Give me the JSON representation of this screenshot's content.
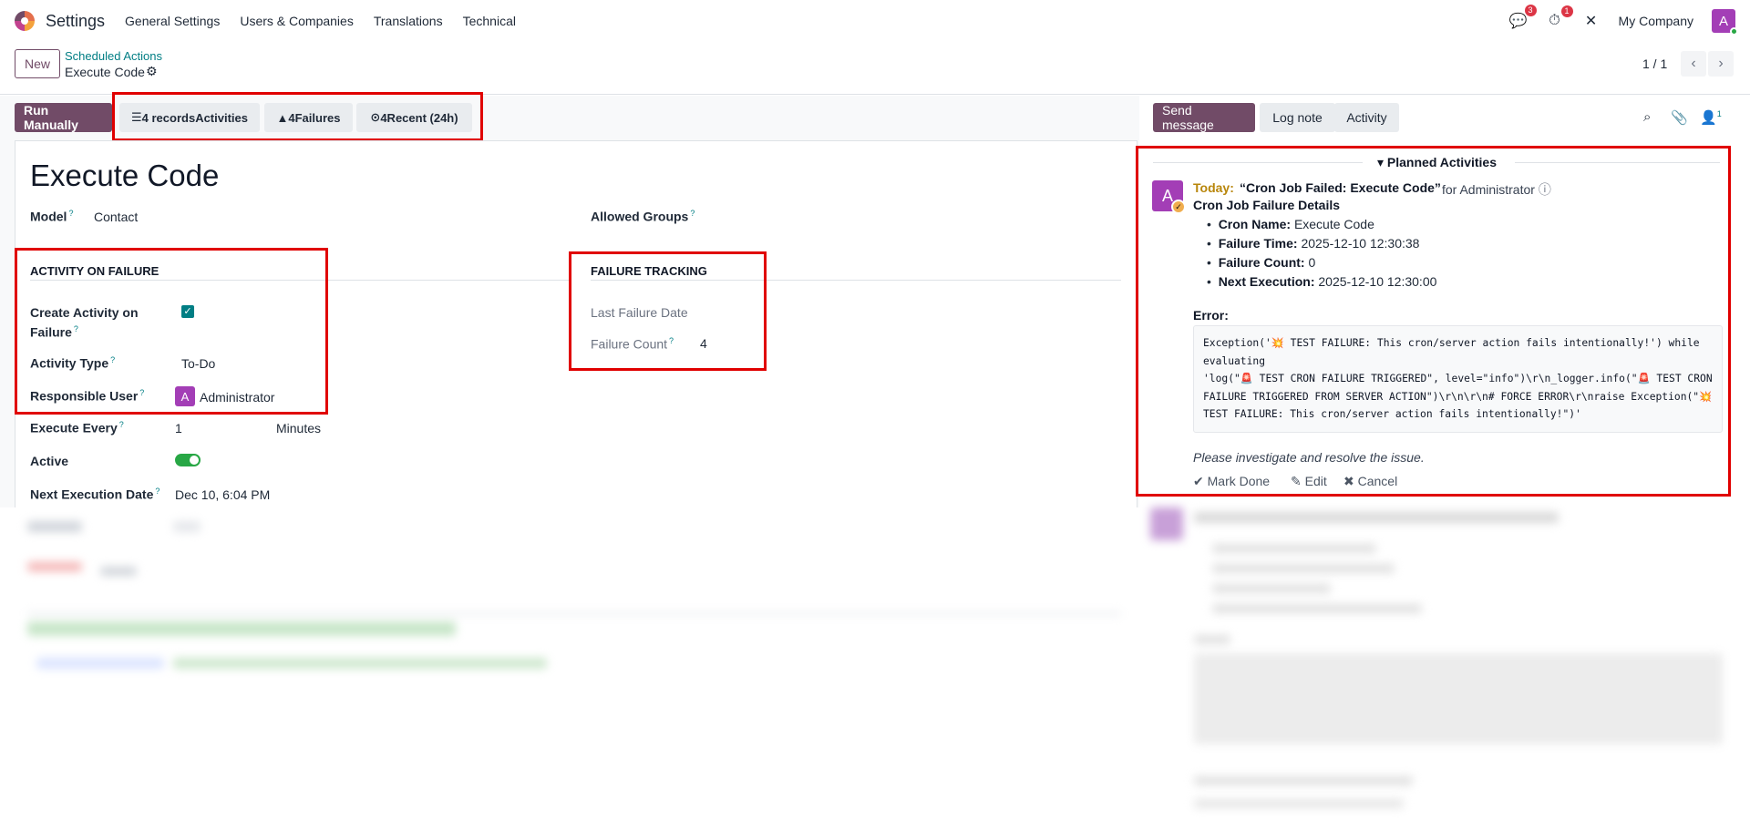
{
  "navbar": {
    "app_name": "Settings",
    "menu": [
      "General Settings",
      "Users & Companies",
      "Translations",
      "Technical"
    ],
    "messages_badge": "3",
    "activities_badge": "1",
    "company": "My Company",
    "user_initial": "A"
  },
  "control": {
    "new_label": "New",
    "breadcrumb": "Scheduled Actions",
    "record_name": "Execute Code",
    "pager": "1 / 1"
  },
  "buttons": {
    "run_manually": "Run Manually",
    "activities": "4 recordsActivities",
    "failures": "4Failures",
    "recent": "4Recent (24h)"
  },
  "form": {
    "title": "Execute Code",
    "model_label": "Model",
    "model_value": "Contact",
    "allowed_groups_label": "Allowed Groups",
    "activity_section": "ACTIVITY ON FAILURE",
    "create_activity_label_1": "Create Activity on",
    "create_activity_label_2": "Failure",
    "activity_type_label": "Activity Type",
    "activity_type_value": "To-Do",
    "responsible_label": "Responsible User",
    "responsible_value": "Administrator",
    "responsible_initial": "A",
    "execute_every_label": "Execute Every",
    "execute_every_value": "1",
    "execute_every_unit": "Minutes",
    "active_label": "Active",
    "next_exec_label": "Next Execution Date",
    "next_exec_value": "Dec 10, 6:04 PM",
    "failure_section": "FAILURE TRACKING",
    "last_failure_label": "Last Failure Date",
    "failure_count_label": "Failure Count",
    "failure_count_value": "4"
  },
  "chatter": {
    "send_message": "Send message",
    "log_note": "Log note",
    "activity": "Activity",
    "followers_count": "1",
    "planned_title": "Planned Activities",
    "avatar_initial": "A",
    "today": "Today:",
    "summary": "“Cron Job Failed: Execute Code”",
    "for_user": "for Administrator",
    "details_title": "Cron Job Failure Details",
    "bullets": [
      {
        "key": "Cron Name:",
        "value": "Execute Code"
      },
      {
        "key": "Failure Time:",
        "value": "2025-12-10 12:30:38"
      },
      {
        "key": "Failure Count:",
        "value": "0"
      },
      {
        "key": "Next Execution:",
        "value": "2025-12-10 12:30:00"
      }
    ],
    "error_label": "Error:",
    "error_code": "Exception('💥 TEST FAILURE: This cron/server action fails intentionally!') while evaluating\n'log(\"🚨 TEST CRON FAILURE TRIGGERED\", level=\"info\")\\r\\n_logger.info(\"🚨 TEST CRON FAILURE TRIGGERED FROM SERVER ACTION\")\\r\\n\\r\\n# FORCE ERROR\\r\\nraise Exception(\"💥 TEST FAILURE: This cron/server action fails intentionally!\")'",
    "investigate": "Please investigate and resolve the issue.",
    "mark_done": "Mark Done",
    "edit": "Edit",
    "cancel": "Cancel"
  },
  "colors": {
    "primary": "#714b67",
    "link": "#017e84",
    "highlight": "#e00000"
  }
}
